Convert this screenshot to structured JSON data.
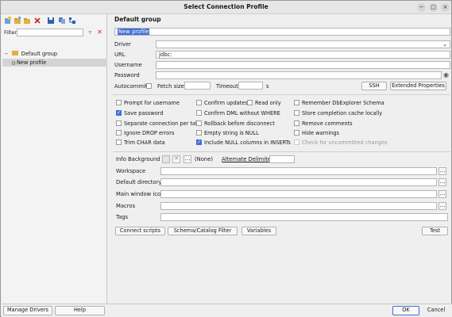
{
  "window": {
    "title": "Select Connection Profile",
    "controls": [
      "−",
      "□",
      "×"
    ]
  },
  "left": {
    "toolbar": [
      "new-connection-icon",
      "new-group-icon",
      "folder-icon",
      "delete-icon",
      "save-icon",
      "copy-icon",
      "tree-icon"
    ],
    "filter_label": "Filter",
    "tree": {
      "group": "Default group",
      "profile": "New profile"
    }
  },
  "form": {
    "group_title": "Default group",
    "profile_name": "New profile",
    "driver_label": "Driver",
    "url_label": "URL",
    "url_value": "jdbc:",
    "username_label": "Username",
    "password_label": "Password",
    "autocommit_label": "Autocommit",
    "fetch_size_label": "Fetch size",
    "timeout_label": "Timeout",
    "timeout_unit": "s",
    "ssh_label": "SSH",
    "extended_label": "Extended Properties"
  },
  "options": {
    "col1": [
      {
        "label": "Prompt for username",
        "checked": false
      },
      {
        "label": "Save password",
        "checked": true
      },
      {
        "label": "Separate connection per tab",
        "checked": false
      },
      {
        "label": "Ignore DROP errors",
        "checked": false
      },
      {
        "label": "Trim CHAR data",
        "checked": false
      }
    ],
    "col2": [
      {
        "label": "Confirm updates",
        "checked": false
      },
      {
        "label": "Confirm DML without WHERE",
        "checked": false
      },
      {
        "label": "Rollback before disconnect",
        "checked": false
      },
      {
        "label": "Empty string is NULL",
        "checked": false
      },
      {
        "label": "Include NULL columns in INSERTs",
        "checked": true
      }
    ],
    "readonly": {
      "label": "Read only",
      "checked": false
    },
    "col3": [
      {
        "label": "Remember DbExplorer Schema",
        "checked": false
      },
      {
        "label": "Store completion cache locally",
        "checked": false
      },
      {
        "label": "Remove comments",
        "checked": false
      },
      {
        "label": "Hide warnings",
        "checked": false
      },
      {
        "label": "Check for uncommitted changes",
        "checked": false,
        "disabled": true
      }
    ]
  },
  "info": {
    "background_label": "Info Background",
    "none_label": "(None)",
    "alt_delim_label": "Alternate Delimiter"
  },
  "paths": {
    "workspace": "Workspace",
    "default_directory": "Default directory",
    "main_window_icon": "Main window icon",
    "macros": "Macros",
    "tags": "Tags"
  },
  "actions": {
    "connect_scripts": "Connect scripts",
    "schema_filter": "Schema/Catalog Filter",
    "variables": "Variables",
    "test": "Test"
  },
  "bottom": {
    "manage_drivers": "Manage Drivers",
    "help": "Help",
    "ok": "OK",
    "cancel": "Cancel"
  },
  "colors": {
    "accent": "#3d6fd6",
    "selection": "#d4d4d4",
    "panel": "#efefef"
  }
}
